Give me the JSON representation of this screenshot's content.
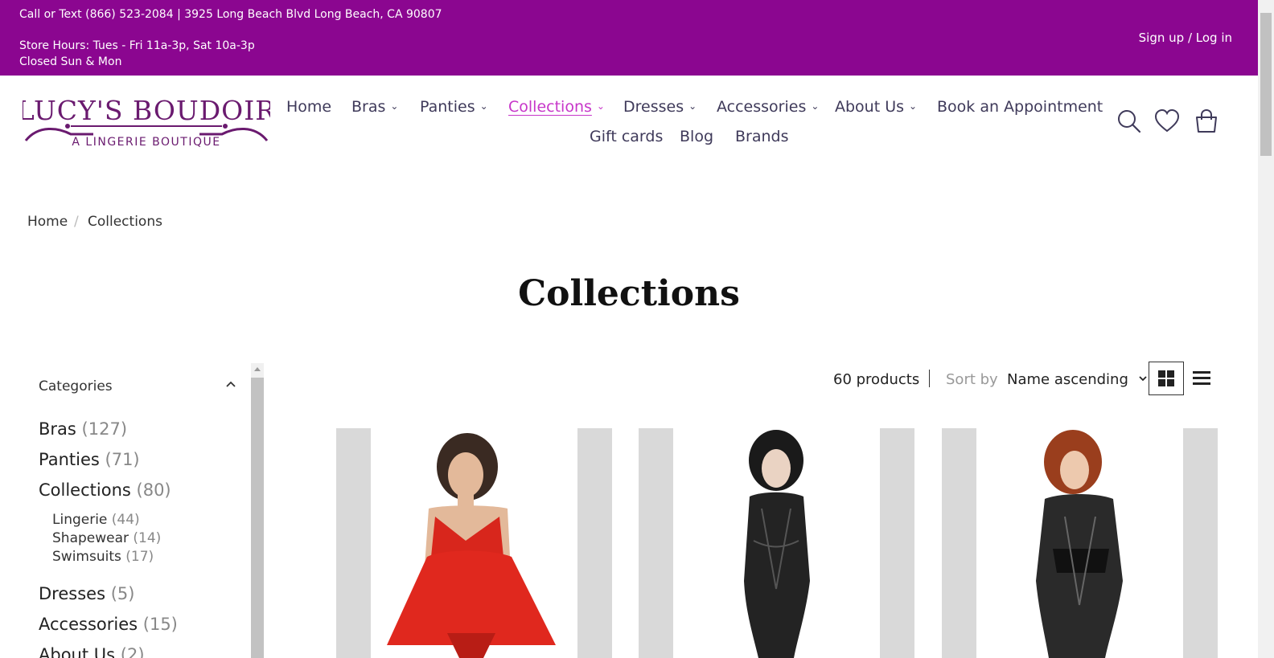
{
  "topbar": {
    "contact": "Call or Text (866) 523-2084 | 3925 Long Beach Blvd Long Beach, CA 90807",
    "hours": "Store Hours: Tues - Fri 11a-3p, Sat 10a-3p",
    "closed": "Closed Sun & Mon",
    "login": "Sign up / Log in"
  },
  "logo": {
    "name": "LUCY'S BOUDOIR",
    "tagline": "A LINGERIE BOUTIQUE"
  },
  "nav": {
    "home": "Home",
    "bras": "Bras",
    "panties": "Panties",
    "collections": "Collections",
    "dresses": "Dresses",
    "accessories": "Accessories",
    "about": "About Us",
    "appointment": "Book an Appointment",
    "giftcards": "Gift cards",
    "blog": "Blog",
    "brands": "Brands"
  },
  "breadcrumb": {
    "home": "Home",
    "current": "Collections"
  },
  "page_title": "Collections",
  "sidebar": {
    "heading": "Categories",
    "categories": [
      {
        "label": "Bras",
        "count": "(127)"
      },
      {
        "label": "Panties",
        "count": "(71)"
      },
      {
        "label": "Collections",
        "count": "(80)"
      },
      {
        "label": "Dresses",
        "count": "(5)"
      },
      {
        "label": "Accessories",
        "count": "(15)"
      },
      {
        "label": "About Us",
        "count": "(2)"
      }
    ],
    "subcategories": [
      {
        "label": "Lingerie",
        "count": "(44)"
      },
      {
        "label": "Shapewear",
        "count": "(14)"
      },
      {
        "label": "Swimsuits",
        "count": "(17)"
      }
    ]
  },
  "toolbar": {
    "count": "60 products",
    "sort_label": "Sort by",
    "sort_value": "Name ascending"
  },
  "icons": {
    "search": "search-icon",
    "wishlist": "heart-icon",
    "cart": "shopping-bag-icon",
    "grid": "grid-view-icon",
    "list": "list-view-icon"
  },
  "colors": {
    "topbar": "#8b0690",
    "nav_active": "#c736c9",
    "brand": "#6a1a6f"
  }
}
